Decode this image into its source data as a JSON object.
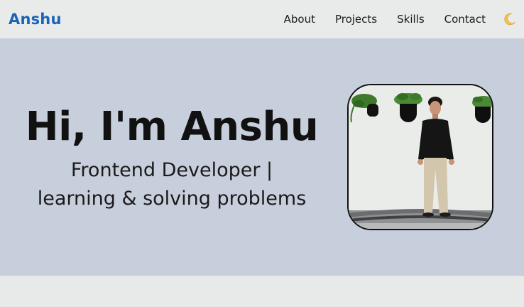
{
  "header": {
    "brand": "Anshu",
    "nav": [
      {
        "label": "About"
      },
      {
        "label": "Projects"
      },
      {
        "label": "Skills"
      },
      {
        "label": "Contact"
      }
    ],
    "theme_toggle_icon": "moon-icon"
  },
  "hero": {
    "title": "Hi, I'm Anshu",
    "subtitle_line1": "Frontend Developer |",
    "subtitle_line2": "learning & solving problems",
    "photo_icon": "profile-photo"
  },
  "colors": {
    "brand": "#1a64b8",
    "nav_bg": "#e9ebeb",
    "hero_bg": "#c8cfdc",
    "footer_bg": "#e8eaea",
    "moon": "#f2c14e"
  }
}
